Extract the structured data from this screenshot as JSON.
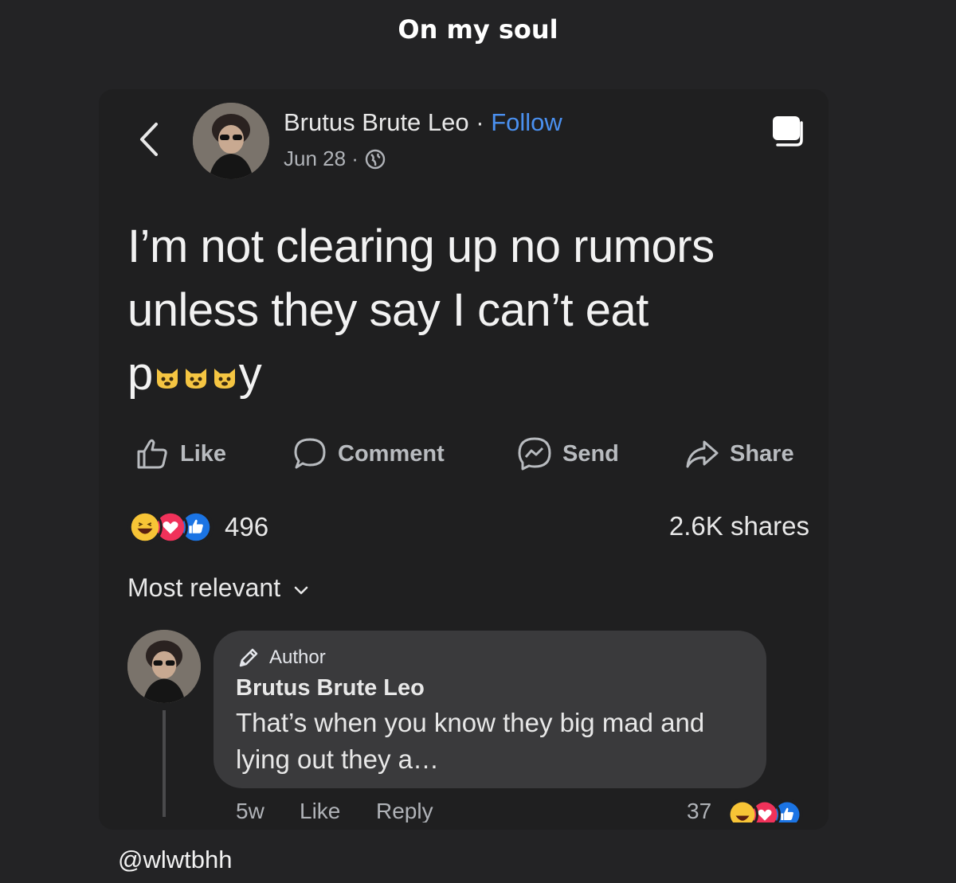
{
  "caption": "On my soul",
  "post": {
    "author": "Brutus Brute Leo",
    "separator": "·",
    "follow_label": "Follow",
    "date": "Jun 28 ·",
    "text_line1": "I’m not clearing up no rumors",
    "text_line2": "unless they say I can’t eat",
    "text_p": "p",
    "text_y": "y"
  },
  "actions": {
    "like": "Like",
    "comment": "Comment",
    "send": "Send",
    "share": "Share"
  },
  "stats": {
    "reaction_count": "496",
    "shares": "2.6K shares"
  },
  "sort": {
    "label": "Most relevant"
  },
  "comment": {
    "badge": "Author",
    "name": "Brutus Brute Leo",
    "text": "That’s when you know they big mad and lying out they a…",
    "time": "5w",
    "like": "Like",
    "reply": "Reply",
    "reaction_count": "37"
  },
  "watermark": "@wlwtbhh",
  "icons": [
    "back-icon",
    "globe-icon",
    "save-icon",
    "like-icon",
    "comment-icon",
    "messenger-icon",
    "share-icon",
    "chevron-down-icon",
    "pencil-icon",
    "haha-reaction-icon",
    "love-reaction-icon",
    "like-reaction-icon",
    "cat-emoji-icon"
  ],
  "colors": {
    "accent": "#4a90f0",
    "background": "#232325",
    "bubble": "#3a3a3c"
  }
}
